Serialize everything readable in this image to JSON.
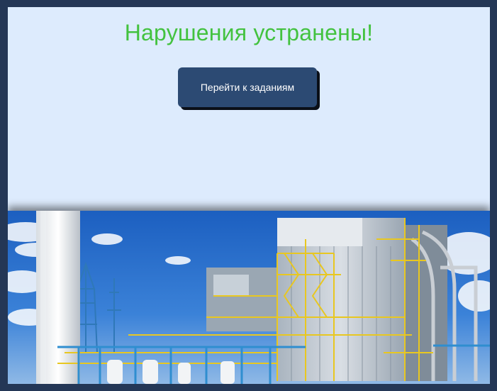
{
  "message": {
    "title": "Нарушения устранены!"
  },
  "actions": {
    "goto_tasks_label": "Перейти к заданиям"
  },
  "colors": {
    "frame": "#243756",
    "panel_background": "#ddebfd",
    "title_green": "#43c23f",
    "button_background": "#2c4a73",
    "button_text": "#ffffff"
  },
  "image": {
    "subject": "industrial-plant-photo"
  }
}
